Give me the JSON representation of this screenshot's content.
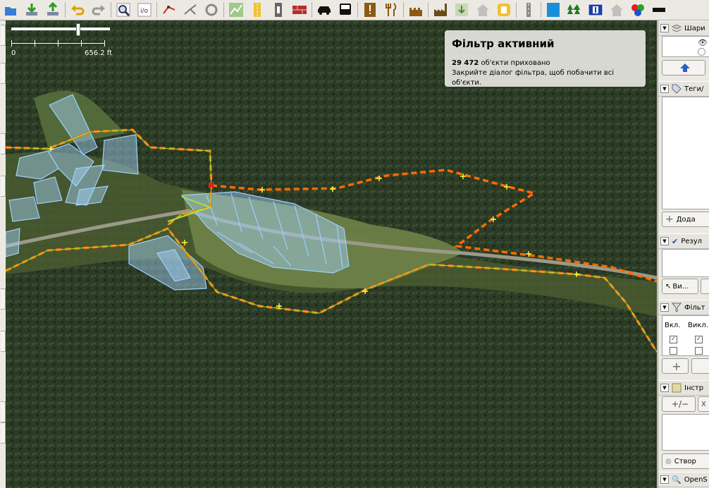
{
  "scale": {
    "start": "0",
    "end": "656.2 ft"
  },
  "filter_notice": {
    "title": "Фільтр активний",
    "count": "29 472",
    "hidden_text": "об'єкти приховано",
    "hint": "Закрийте діалог фільтра, щоб побачити всі об'єкти."
  },
  "panels": {
    "layers": {
      "title": "Шари"
    },
    "tags": {
      "title": "Теги/",
      "add_label": "Дода"
    },
    "results": {
      "title": "Резул",
      "view_label": "Ви..."
    },
    "filters": {
      "title": "Фільт",
      "col_enabled": "Вкл.",
      "col_excluded": "Викл."
    },
    "tools": {
      "title": "Інстр",
      "create_label": "Створ"
    },
    "bottom": {
      "title": "OpenS"
    }
  },
  "colors": {
    "road": "#ff6a00",
    "area": "#a8d8ff",
    "selection": "#ffff40"
  }
}
